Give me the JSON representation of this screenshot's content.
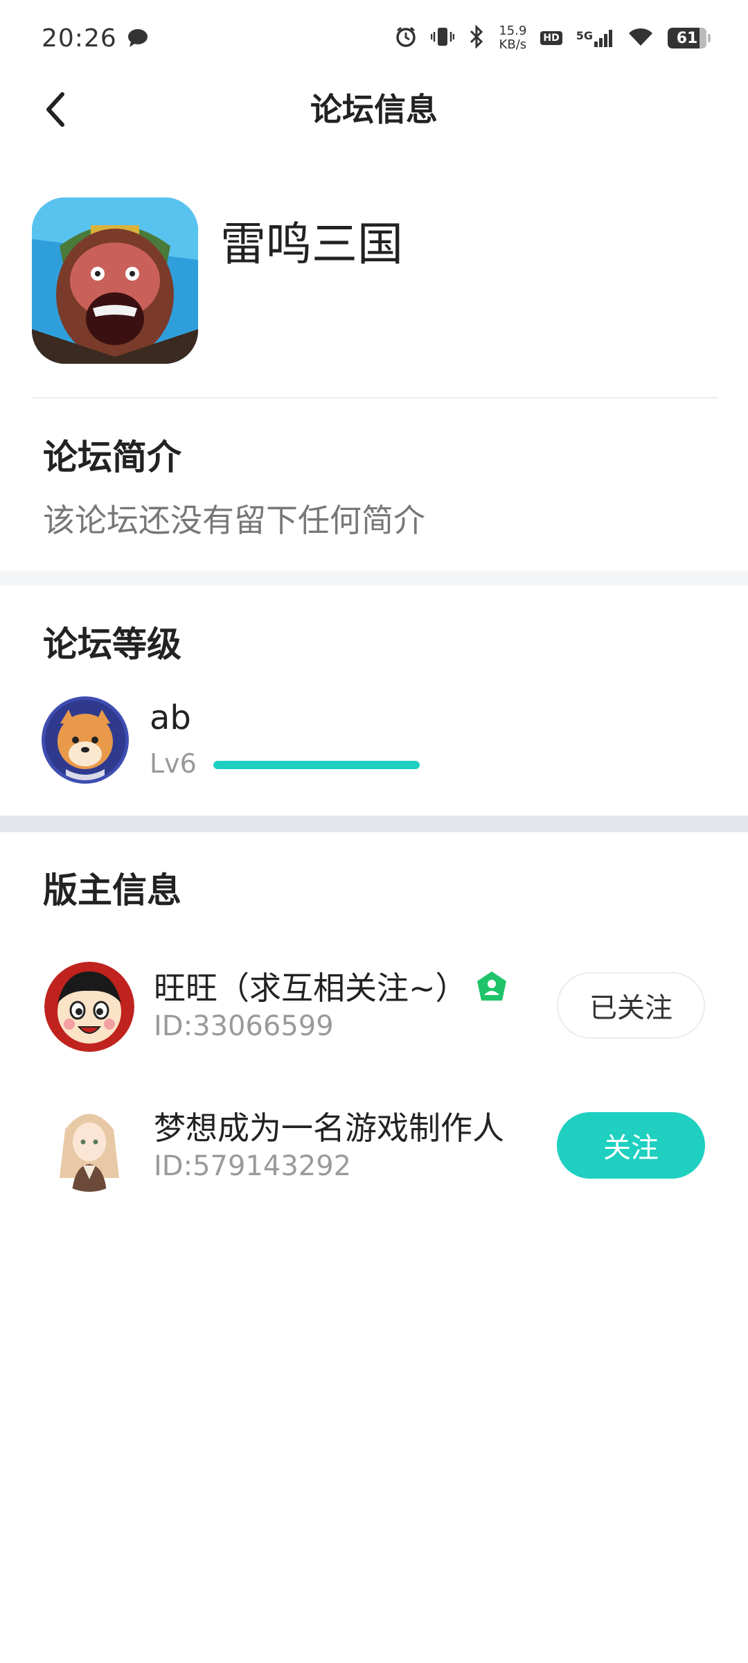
{
  "status_bar": {
    "time": "20:26",
    "net_speed_value": "15.9",
    "net_speed_unit": "KB/s",
    "hd": "HD",
    "signal": "5G",
    "battery": "61"
  },
  "header": {
    "title": "论坛信息"
  },
  "forum": {
    "name": "雷鸣三国"
  },
  "intro": {
    "title": "论坛简介",
    "text": "该论坛还没有留下任何简介"
  },
  "level": {
    "title": "论坛等级",
    "username": "ab",
    "level": "Lv6",
    "progress_percent": 100
  },
  "moderators": {
    "title": "版主信息",
    "items": [
      {
        "name": "旺旺（求互相关注~）",
        "id": "ID:33066599",
        "button": "已关注",
        "followed": true
      },
      {
        "name": "梦想成为一名游戏制作人",
        "id": "ID:579143292",
        "button": "关注",
        "followed": false
      }
    ]
  },
  "colors": {
    "accent": "#1fd0c1",
    "badge_green": "#1fc46a"
  }
}
